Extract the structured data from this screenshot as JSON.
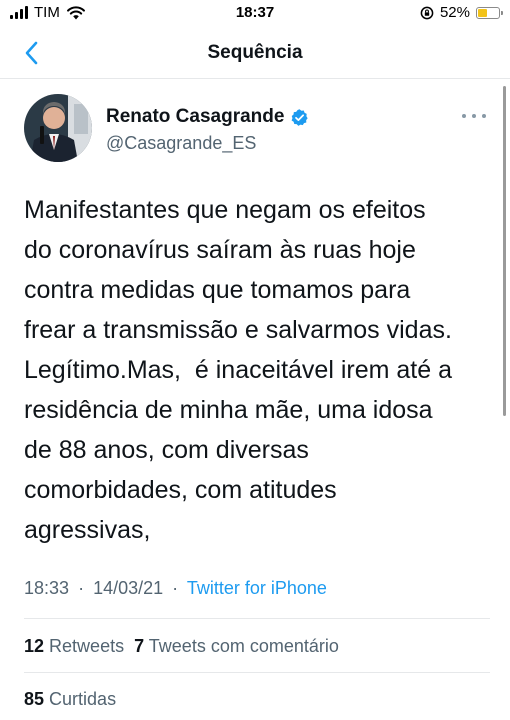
{
  "status_bar": {
    "carrier": "TIM",
    "time": "18:37",
    "battery_percent": "52%",
    "battery_level": 0.52,
    "battery_color": "#f2c31a"
  },
  "nav": {
    "back_icon": "chevron-left-icon",
    "title": "Sequência"
  },
  "tweet": {
    "author_name": "Renato Casagrande",
    "verified": true,
    "handle": "@Casagrande_ES",
    "text": "Manifestantes que negam os efeitos\ndo coronavírus saíram às ruas hoje\ncontra medidas que tomamos para\nfrear a transmissão e salvarmos vidas.\nLegítimo.Mas,  é inaceitável irem até a\nresidência de minha mãe, uma idosa\nde 88 anos, com diversas\ncomorbidades, com atitudes\nagressivas,",
    "time": "18:33",
    "date": "14/03/21",
    "separator": "·",
    "source": "Twitter for iPhone"
  },
  "stats": {
    "retweets_count": "12",
    "retweets_label": "Retweets",
    "quotes_count": "7",
    "quotes_label": "Tweets com comentário",
    "likes_count": "85",
    "likes_label": "Curtidas"
  },
  "colors": {
    "accent": "#1d9bf0",
    "verified_badge": "#1d9bf0",
    "secondary_text": "#536471"
  }
}
